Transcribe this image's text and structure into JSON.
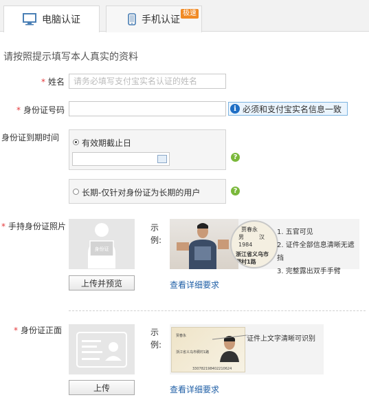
{
  "tabs": [
    {
      "label": "电脑认证",
      "icon": "monitor-icon",
      "active": true
    },
    {
      "label": "手机认证",
      "icon": "phone-icon",
      "active": false,
      "badge": "极速"
    }
  ],
  "intro": "请按照提示填写本人真实的资料",
  "name_field": {
    "label": "姓名",
    "placeholder": "请务必填写支付宝实名认证的姓名"
  },
  "id_field": {
    "label": "身份证号码",
    "value": "",
    "tip": "必须和支付宝实名信息一致"
  },
  "expiry": {
    "label": "身份证到期时间",
    "option_date": "有效期截止日",
    "option_long": "长期-仅针对身份证为长期的用户"
  },
  "hold_photo": {
    "label": "手持身份证照片",
    "placeholder_text": "身份证",
    "example_label": "示例:",
    "card_text": {
      "name": "贾春永",
      "sex": "男",
      "nation": "汉",
      "year": "1984",
      "address": "浙江省义乌市",
      "address2": "稠村1路"
    },
    "requirements": [
      "1. 五官可见",
      "2. 证件全部信息清晰无遮挡",
      "3. 完整露出双手手臂"
    ],
    "upload_button": "上传并预览",
    "detail_link": "查看详细要求"
  },
  "front_photo": {
    "label": "身份证正面",
    "example_label": "示例:",
    "card_text": {
      "name": "贾春永",
      "number": "330782198402210624",
      "address": "浙江省义乌市稠村1路"
    },
    "annotation": "证件上文字清晰可识别",
    "upload_button": "上传",
    "detail_link": "查看详细要求"
  },
  "colors": {
    "required": "#e4393c",
    "link": "#1f5fa6",
    "tip_border": "#7ab3e0",
    "help": "#7ab83a",
    "badge": "#f08a24"
  }
}
